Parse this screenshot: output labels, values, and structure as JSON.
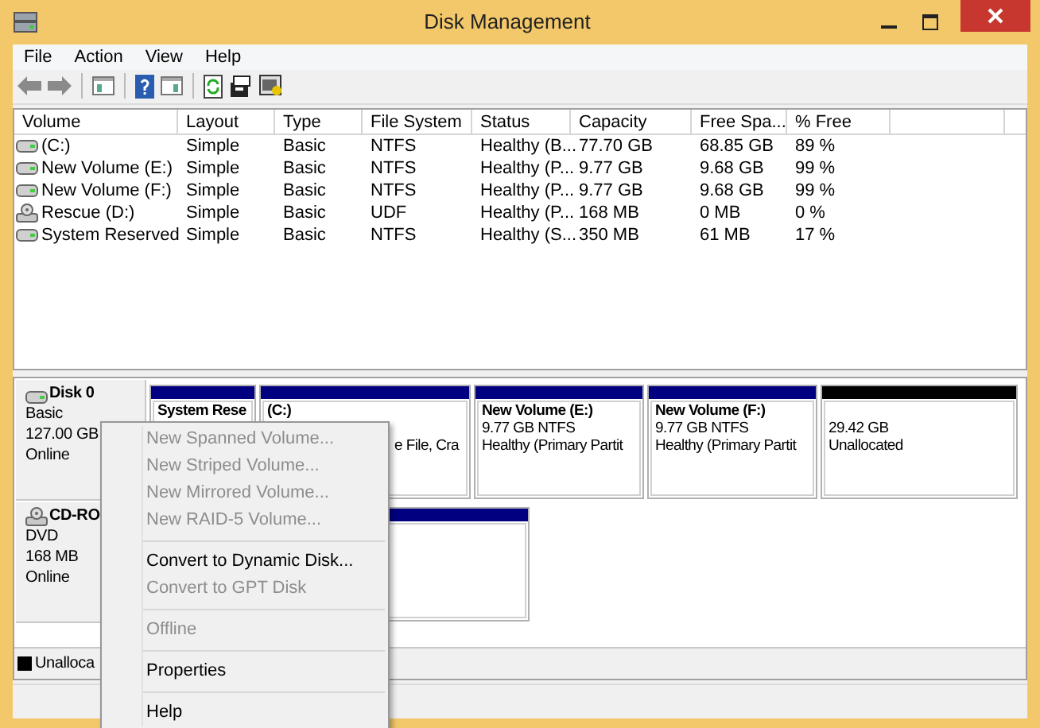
{
  "window": {
    "title": "Disk Management"
  },
  "menu_bar": [
    "File",
    "Action",
    "View",
    "Help"
  ],
  "table": {
    "columns": [
      "Volume",
      "Layout",
      "Type",
      "File System",
      "Status",
      "Capacity",
      "Free Spa...",
      "% Free"
    ],
    "rows": [
      {
        "kind": "disk",
        "cells": [
          "(C:)",
          "Simple",
          "Basic",
          "NTFS",
          "Healthy (B...",
          "77.70 GB",
          "68.85 GB",
          "89 %"
        ]
      },
      {
        "kind": "disk",
        "cells": [
          "New Volume (E:)",
          "Simple",
          "Basic",
          "NTFS",
          "Healthy (P...",
          "9.77 GB",
          "9.68 GB",
          "99 %"
        ]
      },
      {
        "kind": "disk",
        "cells": [
          "New Volume (F:)",
          "Simple",
          "Basic",
          "NTFS",
          "Healthy (P...",
          "9.77 GB",
          "9.68 GB",
          "99 %"
        ]
      },
      {
        "kind": "optical",
        "cells": [
          "Rescue (D:)",
          "Simple",
          "Basic",
          "UDF",
          "Healthy (P...",
          "168 MB",
          "0 MB",
          "0 %"
        ]
      },
      {
        "kind": "disk",
        "cells": [
          "System Reserved",
          "Simple",
          "Basic",
          "NTFS",
          "Healthy (S...",
          "350 MB",
          "61 MB",
          "17 %"
        ]
      }
    ]
  },
  "disks": [
    {
      "kind": "disk",
      "name": "Disk 0",
      "lines": [
        "Basic",
        "127.00 GB",
        "Online"
      ],
      "partitions": [
        {
          "title": "System Rese",
          "color": "#000080"
        },
        {
          "title": "(C:)",
          "lines": [
            "e File, Cra"
          ],
          "color": "#000080"
        },
        {
          "title": "New Volume  (E:)",
          "lines": [
            "9.77 GB NTFS",
            "Healthy (Primary Partit"
          ],
          "color": "#000080"
        },
        {
          "title": "New Volume  (F:)",
          "lines": [
            "9.77 GB NTFS",
            "Healthy (Primary Partit"
          ],
          "color": "#000080"
        },
        {
          "lines": [
            "29.42 GB",
            "Unallocated"
          ],
          "color": "#000000"
        }
      ]
    },
    {
      "kind": "optical",
      "name": "CD-RO",
      "lines": [
        "DVD",
        "168 MB",
        "Online"
      ],
      "partitions": [
        {
          "color": "#000080"
        }
      ]
    }
  ],
  "legend": [
    {
      "label": "Unalloca",
      "color": "#000000"
    }
  ],
  "context_menu": [
    {
      "kind": "item",
      "label": "New Spanned Volume...",
      "disabled": true
    },
    {
      "kind": "item",
      "label": "New Striped Volume...",
      "disabled": true
    },
    {
      "kind": "item",
      "label": "New Mirrored Volume...",
      "disabled": true
    },
    {
      "kind": "item",
      "label": "New RAID-5 Volume...",
      "disabled": true
    },
    {
      "kind": "separator"
    },
    {
      "kind": "item",
      "label": "Convert to Dynamic Disk...",
      "disabled": false
    },
    {
      "kind": "item",
      "label": "Convert to GPT Disk",
      "disabled": true
    },
    {
      "kind": "separator"
    },
    {
      "kind": "item",
      "label": "Offline",
      "disabled": true
    },
    {
      "kind": "separator"
    },
    {
      "kind": "item",
      "label": "Properties",
      "disabled": false
    },
    {
      "kind": "separator"
    },
    {
      "kind": "item",
      "label": "Help",
      "disabled": false
    }
  ]
}
